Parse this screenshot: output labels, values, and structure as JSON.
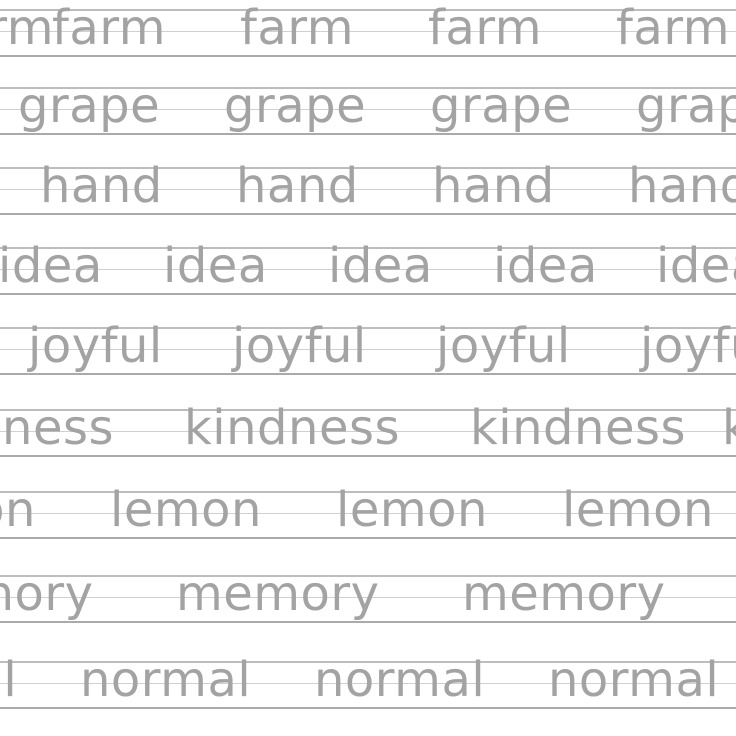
{
  "worksheet": {
    "rows": [
      {
        "word": "farm"
      },
      {
        "word": "grape"
      },
      {
        "word": "hand"
      },
      {
        "word": "idea"
      },
      {
        "word": "joyful"
      },
      {
        "word": "kindness"
      },
      {
        "word": "lemon"
      },
      {
        "word": "memory"
      },
      {
        "word": "normal"
      }
    ]
  }
}
